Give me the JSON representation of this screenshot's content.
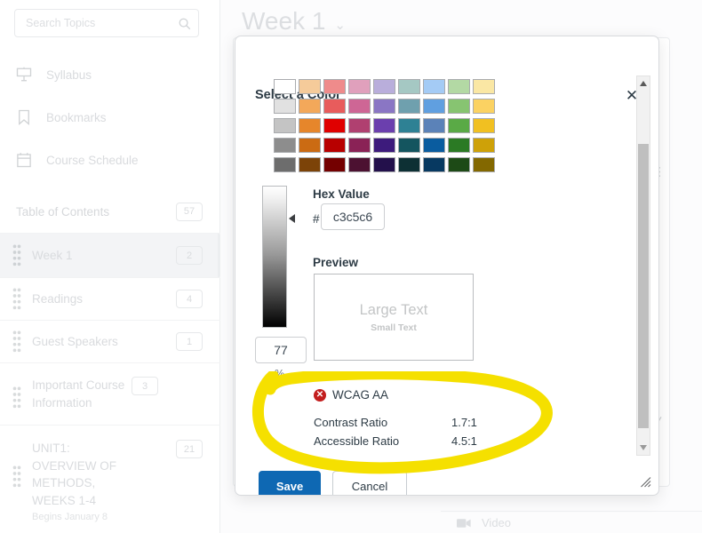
{
  "sidebar": {
    "search": {
      "placeholder": "Search Topics",
      "value": "",
      "icon": "search-icon"
    },
    "nav": [
      {
        "label": "Syllabus",
        "icon": "syllabus-icon"
      },
      {
        "label": "Bookmarks",
        "icon": "bookmark-icon"
      },
      {
        "label": "Course Schedule",
        "icon": "calendar-icon"
      }
    ],
    "toc": {
      "label": "Table of Contents",
      "count": "57"
    },
    "items": [
      {
        "label": "Week 1",
        "count": "2",
        "sub": "",
        "active": true
      },
      {
        "label": "Readings",
        "count": "4",
        "sub": "",
        "active": false
      },
      {
        "label": "Guest Speakers",
        "count": "1",
        "sub": "",
        "active": false
      },
      {
        "label": "Important Course Information",
        "count": "3",
        "sub": "",
        "active": false
      },
      {
        "label": "UNIT1: OVERVIEW OF METHODS, WEEKS 1-4",
        "count": "21",
        "sub": "Begins January 8",
        "active": false
      }
    ]
  },
  "content": {
    "page_title": "Week 1",
    "chevron": "⌄",
    "video_label": "Video",
    "toolbar_icons": [
      "list-unordered-icon",
      "list-ordered-icon",
      "undo-icon",
      "dropdown-caret-icon",
      "spellcheck-icon"
    ]
  },
  "modal": {
    "title": "Select a Color",
    "close_label": "✕",
    "palette": {
      "rows": [
        [
          "#ffffff",
          "#f5cb9a",
          "#ef8b8b",
          "#e0a0bc",
          "#b9aedb",
          "#a5c8c3",
          "#a4cbf5",
          "#b3d9a4",
          "#fae7a4"
        ],
        [
          "#e1e1e1",
          "#f3a85a",
          "#e85c5c",
          "#ce6695",
          "#8a76c4",
          "#6fa0ae",
          "#609fe0",
          "#87c471",
          "#fbd262"
        ],
        [
          "#c4c4c4",
          "#e6862b",
          "#e00000",
          "#b04070",
          "#6b3fae",
          "#2e8194",
          "#5b82b8",
          "#5aaa46",
          "#f1c021"
        ],
        [
          "#8d8d8d",
          "#cb6b13",
          "#b80000",
          "#8a2256",
          "#3d1b7c",
          "#14555f",
          "#0a5c9f",
          "#2b7a24",
          "#cea108"
        ],
        [
          "#6d6d6d",
          "#7c4308",
          "#740000",
          "#4c1131",
          "#23104b",
          "#0d3034",
          "#073961",
          "#1d4a16",
          "#836800"
        ]
      ]
    },
    "scrollbar": {
      "up_arrow": "▲",
      "down_arrow": "▼"
    },
    "slider": {
      "percent_value": "77",
      "percent_sign": "%"
    },
    "hex": {
      "label": "Hex Value",
      "hash": "#",
      "value": "c3c5c6"
    },
    "preview": {
      "label": "Preview",
      "large_text": "Large Text",
      "small_text": "Small Text",
      "swatch_color": "#c3c5c6"
    },
    "wcag": {
      "status_icon": "fail-icon",
      "status_mark": "✕",
      "heading": "WCAG AA",
      "rows": [
        {
          "key": "Contrast Ratio",
          "value": "1.7:1"
        },
        {
          "key": "Accessible Ratio",
          "value": "4.5:1"
        }
      ]
    },
    "buttons": {
      "save": "Save",
      "cancel": "Cancel"
    },
    "resize_handle": "resize-grip-icon"
  },
  "colors": {
    "primary_button": "#0e68b3",
    "fail_red": "#c31e1e",
    "annotation_yellow": "#f5e000",
    "text_dark": "#2d3b45"
  }
}
